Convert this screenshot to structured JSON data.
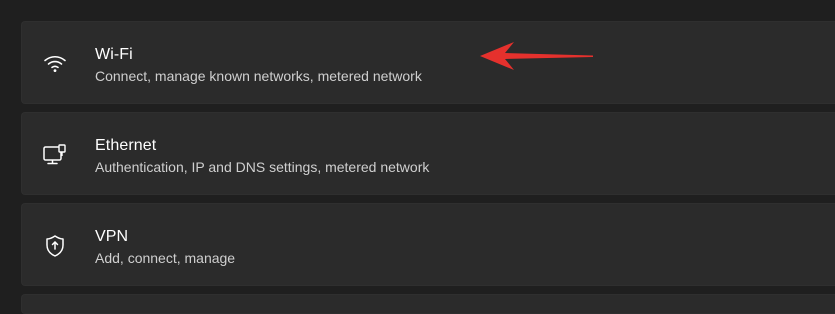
{
  "settings": {
    "items": [
      {
        "title": "Wi-Fi",
        "subtitle": "Connect, manage known networks, metered network",
        "icon": "wifi-icon"
      },
      {
        "title": "Ethernet",
        "subtitle": "Authentication, IP and DNS settings, metered network",
        "icon": "ethernet-icon"
      },
      {
        "title": "VPN",
        "subtitle": "Add, connect, manage",
        "icon": "shield-icon"
      }
    ]
  },
  "colors": {
    "background": "#1f1f1f",
    "card": "#2b2b2b",
    "title_text": "#ffffff",
    "subtitle_text": "#cfcfcf",
    "annotation_arrow": "#e5312d"
  },
  "annotation": {
    "icon": "red-arrow-icon",
    "points_to": "Wi-Fi"
  }
}
